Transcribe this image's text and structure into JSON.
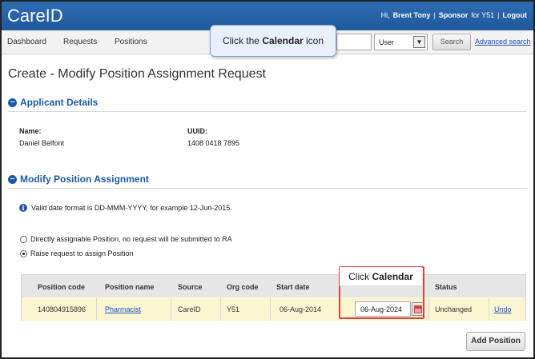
{
  "app": {
    "title": "CareID"
  },
  "user_bar": {
    "greeting": "Hi,",
    "user_name": "Brent Tony",
    "separator": "|",
    "sponsor_label": "Sponsor",
    "sponsor_for": "for Y51",
    "logout": "Logout"
  },
  "nav": {
    "items": [
      "Dashboard",
      "Requests",
      "Positions"
    ],
    "search_placeholder": "",
    "select_value": "User",
    "search_button": "Search",
    "advanced_search": "Advanced search"
  },
  "callout_top": {
    "prefix": "Click the",
    "bold": "Calendar",
    "suffix": "icon"
  },
  "page": {
    "title": "Create - Modify Position Assignment Request"
  },
  "applicant": {
    "section_title": "Applicant Details",
    "name_label": "Name:",
    "name_value": "Daniel Belfont",
    "uuid_label": "UUID:",
    "uuid_value": "1408 0418 7895"
  },
  "modify": {
    "section_title": "Modify Position Assignment",
    "info": "Valid date format is DD-MMM-YYYY, for example 12-Jun-2015.",
    "option_direct": "Directly assignable Position, no request will be submitted to RA",
    "option_raise": "Raise request to assign Position",
    "selected_option": "raise"
  },
  "table": {
    "headers": [
      "Position code",
      "Position name",
      "Source",
      "Org code",
      "Start date",
      "Status"
    ],
    "row": {
      "position_code": "140804915896",
      "position_name": "Pharmacist",
      "source": "CareID",
      "org_code": "Y51",
      "start_date": "06-Aug-2014",
      "end_date_value": "06-Aug-2024",
      "status": "Unchanged",
      "undo": "Undo"
    }
  },
  "callout_table": {
    "prefix": "Click",
    "bold": "Calendar"
  },
  "buttons": {
    "add_position": "Add Position"
  },
  "colors": {
    "header_blue": "#1f579b",
    "accent_blue": "#1e5aa8",
    "highlight_row": "#fbf5d2",
    "callout_red": "#e0423a"
  }
}
